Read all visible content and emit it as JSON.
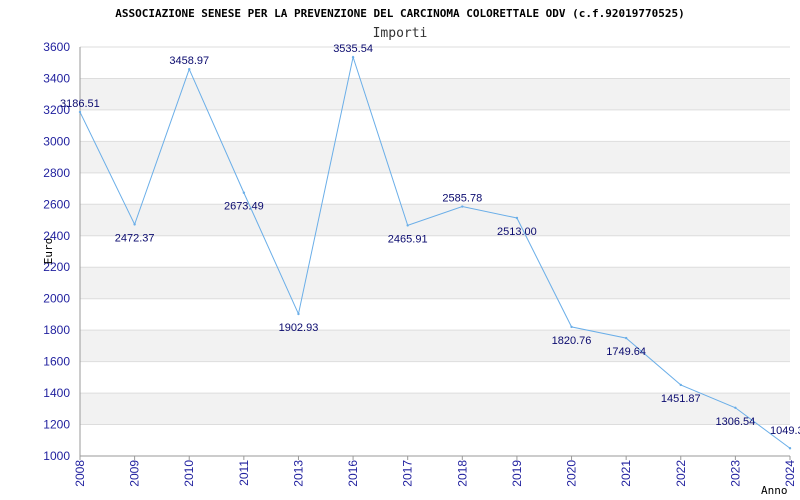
{
  "chart_data": {
    "type": "line",
    "title": "ASSOCIAZIONE SENESE PER LA PREVENZIONE DEL CARCINOMA COLORETTALE ODV (c.f.92019770525)",
    "subtitle": "Importi",
    "xlabel": "Anno",
    "ylabel": "Euro",
    "ylim": [
      1000,
      3600
    ],
    "yticks": [
      1000,
      1200,
      1400,
      1600,
      1800,
      2000,
      2200,
      2400,
      2600,
      2800,
      3000,
      3200,
      3400,
      3600
    ],
    "categories": [
      "2008",
      "2009",
      "2010",
      "2011",
      "2013",
      "2016",
      "2017",
      "2018",
      "2019",
      "2020",
      "2021",
      "2022",
      "2023",
      "2024"
    ],
    "values": [
      3186.51,
      2472.37,
      3458.97,
      2673.49,
      1902.93,
      3535.54,
      2465.91,
      2585.78,
      2513.0,
      1820.76,
      1749.64,
      1451.87,
      1306.54,
      1049.3
    ],
    "value_labels": [
      "3186.51",
      "2472.37",
      "3458.97",
      "2673.49",
      "1902.93",
      "3535.54",
      "2465.91",
      "2585.78",
      "2513.00",
      "1820.76",
      "1749.64",
      "1451.87",
      "1306.54",
      "1049.3"
    ],
    "grid": true,
    "colors": {
      "line": "#6aaee8",
      "band": "#f2f2f2",
      "gridline": "#dddddd",
      "tick_text": "#1f1f9e",
      "data_label": "#0a0a6e"
    }
  }
}
